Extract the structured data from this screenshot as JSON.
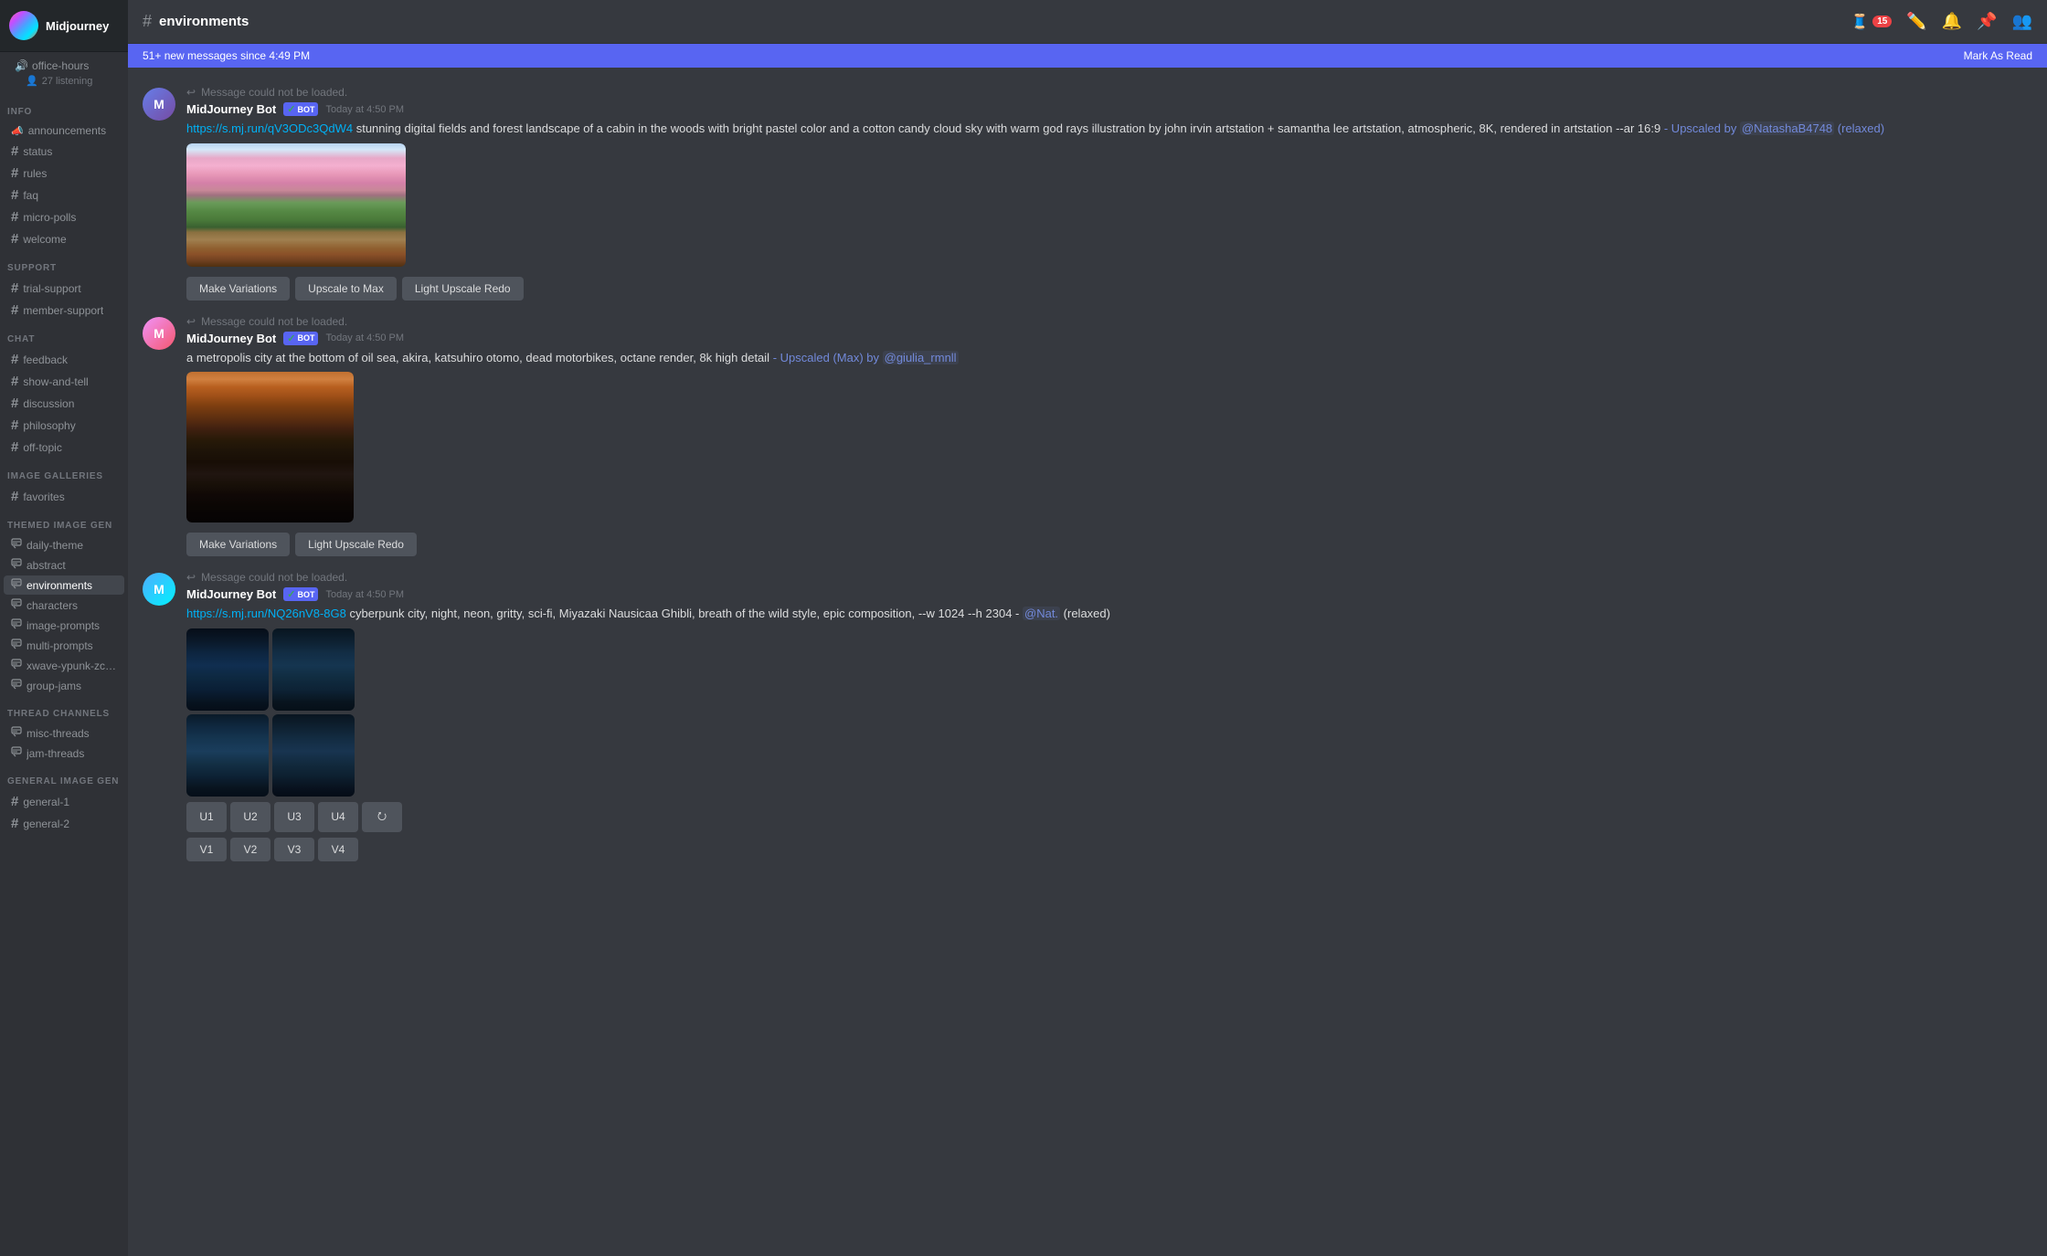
{
  "server": {
    "name": "Midjourney",
    "voice_channel": "office-hours",
    "listening_count": "27 listening"
  },
  "sidebar": {
    "sections": [
      {
        "label": "INFO",
        "channels": [
          {
            "id": "announcements",
            "name": "announcements",
            "icon": "📣",
            "type": "announce"
          },
          {
            "id": "status",
            "name": "status",
            "icon": "#",
            "type": "text"
          },
          {
            "id": "rules",
            "name": "rules",
            "icon": "#",
            "type": "text"
          },
          {
            "id": "faq",
            "name": "faq",
            "icon": "#",
            "type": "text"
          },
          {
            "id": "micro-polls",
            "name": "micro-polls",
            "icon": "#",
            "type": "text"
          },
          {
            "id": "welcome",
            "name": "welcome",
            "icon": "#",
            "type": "text"
          }
        ]
      },
      {
        "label": "SUPPORT",
        "channels": [
          {
            "id": "trial-support",
            "name": "trial-support",
            "icon": "#",
            "type": "text"
          },
          {
            "id": "member-support",
            "name": "member-support",
            "icon": "#",
            "type": "text"
          }
        ]
      },
      {
        "label": "CHAT",
        "channels": [
          {
            "id": "feedback",
            "name": "feedback",
            "icon": "#",
            "type": "text"
          },
          {
            "id": "show-and-tell",
            "name": "show-and-tell",
            "icon": "#",
            "type": "text"
          },
          {
            "id": "discussion",
            "name": "discussion",
            "icon": "#",
            "type": "text"
          },
          {
            "id": "philosophy",
            "name": "philosophy",
            "icon": "#",
            "type": "text"
          },
          {
            "id": "off-topic",
            "name": "off-topic",
            "icon": "#",
            "type": "text"
          }
        ]
      },
      {
        "label": "IMAGE GALLERIES",
        "channels": [
          {
            "id": "favorites",
            "name": "favorites",
            "icon": "#",
            "type": "text"
          }
        ]
      },
      {
        "label": "THEMED IMAGE GEN",
        "channels": [
          {
            "id": "daily-theme",
            "name": "daily-theme",
            "icon": "#",
            "type": "thread"
          },
          {
            "id": "abstract",
            "name": "abstract",
            "icon": "#",
            "type": "thread"
          },
          {
            "id": "environments",
            "name": "environments",
            "icon": "#",
            "type": "thread",
            "active": true
          },
          {
            "id": "characters",
            "name": "characters",
            "icon": "#",
            "type": "thread"
          },
          {
            "id": "image-prompts",
            "name": "image-prompts",
            "icon": "#",
            "type": "thread"
          },
          {
            "id": "multi-prompts",
            "name": "multi-prompts",
            "icon": "#",
            "type": "thread"
          },
          {
            "id": "xwave-ypunk-zcore",
            "name": "xwave-ypunk-zcore",
            "icon": "#",
            "type": "thread"
          },
          {
            "id": "group-jams",
            "name": "group-jams",
            "icon": "#",
            "type": "thread"
          }
        ]
      },
      {
        "label": "THREAD CHANNELS",
        "channels": [
          {
            "id": "misc-threads",
            "name": "misc-threads",
            "icon": "#",
            "type": "thread"
          },
          {
            "id": "jam-threads",
            "name": "jam-threads",
            "icon": "#",
            "type": "thread"
          }
        ]
      },
      {
        "label": "GENERAL IMAGE GEN",
        "channels": [
          {
            "id": "general-1",
            "name": "general-1",
            "icon": "#",
            "type": "text"
          },
          {
            "id": "general-2",
            "name": "general-2",
            "icon": "#",
            "type": "text"
          }
        ]
      }
    ]
  },
  "header": {
    "channel_name": "environments",
    "notification_count": "15",
    "new_messages_text": "51+ new messages since 4:49 PM",
    "mark_as_read": "Mark As Read"
  },
  "messages": [
    {
      "id": "msg1",
      "error": "Message could not be loaded.",
      "author": "MidJourney Bot",
      "is_bot": true,
      "timestamp": "Today at 4:50 PM",
      "link": "https://s.mj.run/qV3ODc3QdW4",
      "text": " stunning digital fields and forest landscape of a cabin in the woods with bright pastel color and a cotton candy cloud sky with warm god rays illustration by john irvin artstation + samantha lee artstation, atmospheric, 8K, rendered in artstation --ar 16:9",
      "suffix": "- Upscaled by @NatashaB4748 (relaxed)",
      "image_type": "forest",
      "buttons": [
        "Make Variations",
        "Upscale to Max",
        "Light Upscale Redo"
      ]
    },
    {
      "id": "msg2",
      "error": "Message could not be loaded.",
      "author": "MidJourney Bot",
      "is_bot": true,
      "timestamp": "Today at 4:50 PM",
      "link": null,
      "text": "a metropolis city at the bottom of oil sea, akira, katsuhiro otomo, dead motorbikes, octane render, 8k high detail",
      "suffix": "- Upscaled (Max) by @giulia_rmnll",
      "image_type": "city",
      "buttons": [
        "Make Variations",
        "Light Upscale Redo"
      ]
    },
    {
      "id": "msg3",
      "error": "Message could not be loaded.",
      "author": "MidJourney Bot",
      "is_bot": true,
      "timestamp": "Today at 4:50 PM",
      "link": "https://s.mj.run/NQ26nV8-8G8",
      "text": " cyberpunk city, night, neon, gritty, sci-fi, Miyazaki Nausicaa Ghibli, breath of the wild style, epic composition, --w 1024 --h 2304",
      "suffix": "- @Nat. (relaxed)",
      "image_type": "cyber",
      "grid_buttons_row1": [
        "U1",
        "U2",
        "U3",
        "U4",
        "⭮"
      ],
      "grid_buttons_row2": [
        "V1",
        "V2",
        "V3",
        "V4"
      ]
    }
  ]
}
